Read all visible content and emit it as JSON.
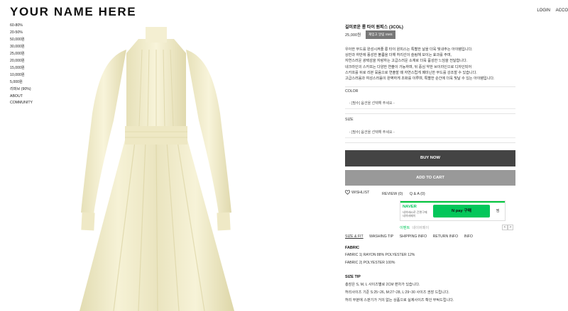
{
  "brand": {
    "logo": "YOUR NAME HERE"
  },
  "categories": [
    "60-80%",
    "20-50%",
    "50,000원",
    "30,000원",
    "25,000원",
    "20,000원",
    "15,000원",
    "10,000원",
    "5,000원",
    "리퍼브 (90%)",
    "ABOUT",
    "COMMUNITY"
  ],
  "top_links": {
    "login": "LOGIN",
    "account": "ACCO"
  },
  "product": {
    "name": "길미로운 롱 타이 원피스 (3COL)",
    "price": "25,000원",
    "sms_button": "재입고 알림 SMS",
    "description": [
      "우아한 무드를 완성시켜줄 롱 타이 원피스는 특별한 날을 더욱 빛내주는 아이템입니다.",
      "상반과 하반에 풍성한 볼륨을 더해 허리선이 슬림해 보이는 효과를 주며,",
      "자연스러운 광택감을 자랑하는 고급스러운 소재로 더욱 품성한 느낌을 전달합니다.",
      "네크라인의 스카프는 다양한 연출이 가능하며, 뒤 중심 약한 브이라인으로 디자인되어",
      "스카프를 뒤로 리본 묶음으로 연출할 때 자연스럽게 페미닌한 무드를 강조할 수 있습니다.",
      "고급스러움과 여성스러움이 완벽하게 조화를 이루며, 특별한 순간에 더욱 빛날 수 있는 아이템입니다."
    ]
  },
  "options": {
    "color_label": "COLOR",
    "color_placeholder": "- [필수] 옵션을 선택해 주세요 -",
    "size_label": "SIZE",
    "size_placeholder": "- [필수] 옵션을 선택해 주세요 -"
  },
  "buttons": {
    "buy_now": "BUY NOW",
    "add_to_cart": "ADD TO CART"
  },
  "actions": {
    "wishlist": "WISHLIST",
    "review": "REVIEW (0)",
    "qa": "Q & A (0)"
  },
  "naverpay": {
    "logo": "NAVER",
    "sub_line1": "네이버ID로 간편구매",
    "sub_line2": "네이버페이",
    "pay_button": "N pay 구매",
    "zzim": "찜",
    "event_label": "이벤트",
    "event_text": "네이버페이",
    "prev": "<",
    "next": ">"
  },
  "tabs": [
    "SIZE & FIT",
    "WASHING TIP",
    "SHIPPING INFO",
    "RETURN INFO",
    "INFO"
  ],
  "fabric": {
    "title": "FABRIC",
    "lines": [
      "FABRIC 1) RAYON 88% POLYESTER 12%",
      "FABRIC 2) POLYESTER 100%"
    ]
  },
  "size_tip": {
    "title": "SIZE TIP",
    "lines": [
      "총장은 S, M, L 사이즈별로 2CM 편차가 있습니다.",
      "허리사이즈 기준 S:25~26, M:27~28, L:29~30 사이즈 권장 드립니다.",
      "허리 부분에 스판기가 거의 없는 상품으로 실제사이즈 확인 부탁드립니다."
    ]
  },
  "colors": {
    "dress": "#f3eecd",
    "dress_shadow": "#ddd6a8",
    "buy_bg": "#444444",
    "cart_bg": "#999999",
    "naver_green": "#03c75a"
  }
}
